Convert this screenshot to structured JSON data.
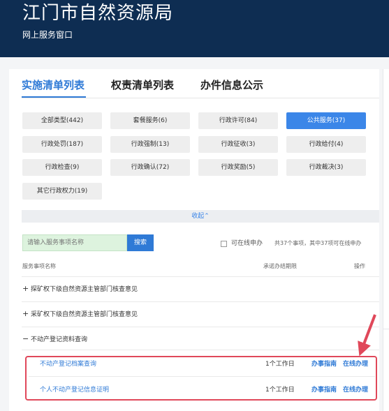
{
  "header": {
    "title": "江门市自然资源局",
    "subtitle": "网上服务窗口"
  },
  "tabs": [
    {
      "label": "实施清单列表",
      "active": true
    },
    {
      "label": "权责清单列表",
      "active": false
    },
    {
      "label": "办件信息公示",
      "active": false
    }
  ],
  "categories": [
    {
      "label": "全部类型(442)",
      "active": false
    },
    {
      "label": "套餐服务(6)",
      "active": false
    },
    {
      "label": "行政许可(84)",
      "active": false
    },
    {
      "label": "公共服务(37)",
      "active": true
    },
    {
      "label": "行政处罚(187)",
      "active": false
    },
    {
      "label": "行政强制(13)",
      "active": false
    },
    {
      "label": "行政征收(3)",
      "active": false
    },
    {
      "label": "行政给付(4)",
      "active": false
    },
    {
      "label": "行政检查(9)",
      "active": false
    },
    {
      "label": "行政确认(72)",
      "active": false
    },
    {
      "label": "行政奖励(5)",
      "active": false
    },
    {
      "label": "行政裁决(3)",
      "active": false
    },
    {
      "label": "其它行政权力(19)",
      "active": false
    }
  ],
  "collapse_label": "收起⌃",
  "search": {
    "placeholder": "请输入服务事项名称",
    "button_label": "搜索"
  },
  "online_filter": {
    "label": "可在线申办",
    "checked": false
  },
  "count_text": "共37个事项，其中37项可在线申办",
  "table": {
    "headers": {
      "name": "服务事项名称",
      "duration": "承诺办结期限",
      "actions": "操作"
    },
    "groups": [
      {
        "symbol": "+",
        "label": "探矿权下级自然资源主管部门核查意见"
      },
      {
        "symbol": "+",
        "label": "采矿权下级自然资源主管部门核查意见"
      },
      {
        "symbol": "−",
        "label": "不动产登记资料查询"
      }
    ],
    "sub_items": [
      {
        "name": "不动产登记档案查询",
        "duration": "1个工作日",
        "guide": "办事指南",
        "apply": "在线办理"
      },
      {
        "name": "个人不动产登记信息证明",
        "duration": "1个工作日",
        "guide": "办事指南",
        "apply": "在线办理"
      }
    ]
  },
  "colors": {
    "header_bg": "#0e2d52",
    "accent": "#2f7ad6",
    "highlight": "#e0485a",
    "search_bg": "#ddf3de"
  }
}
